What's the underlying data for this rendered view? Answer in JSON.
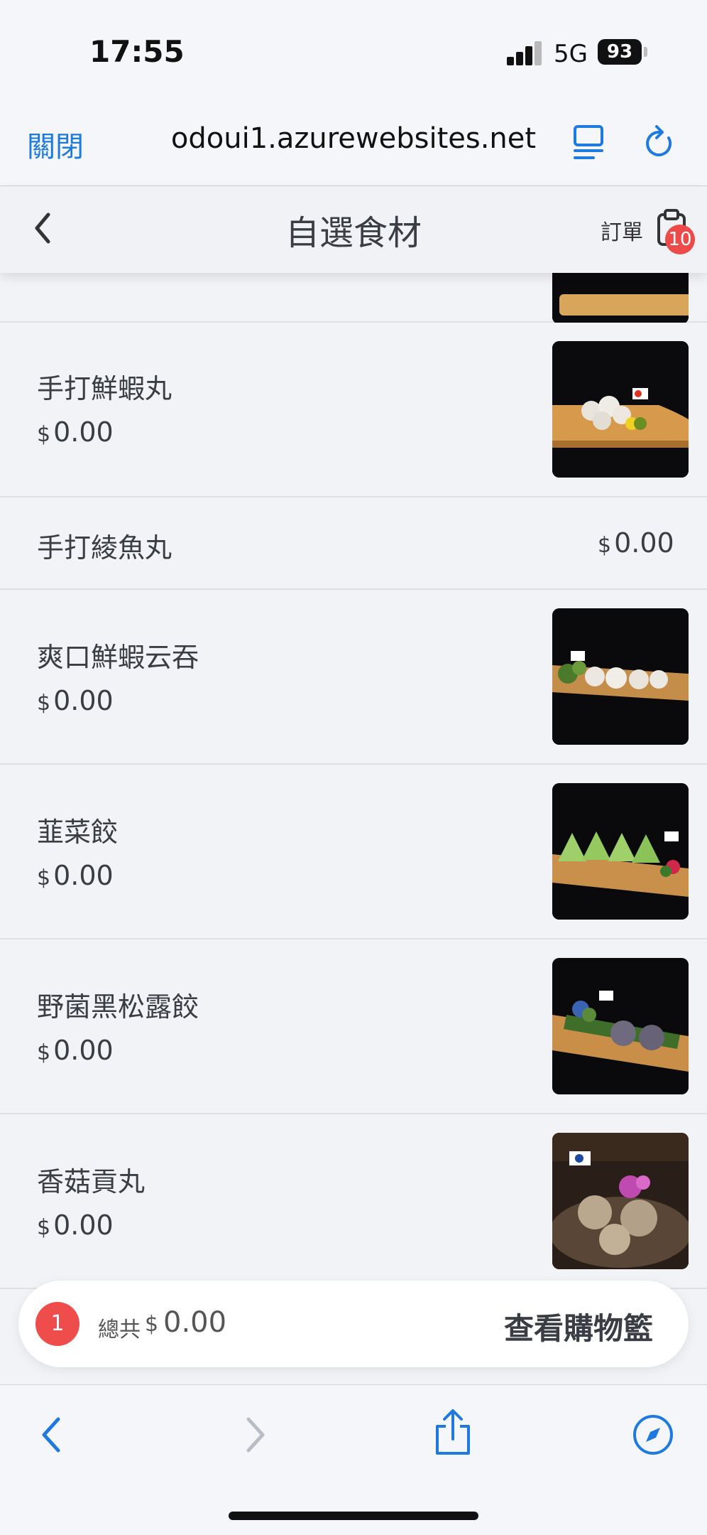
{
  "status_bar": {
    "time": "17:55",
    "network": "5G",
    "battery": "93"
  },
  "browser": {
    "close_label": "關閉",
    "url": "odoui1.azurewebsites.net"
  },
  "header": {
    "title": "自選食材",
    "order_label": "訂單",
    "order_badge": "10"
  },
  "items": [
    {
      "name": "手打鮮蝦丸",
      "currency": "$",
      "price": "0.00"
    },
    {
      "name": "手打綾魚丸",
      "currency": "$",
      "price": "0.00"
    },
    {
      "name": "爽口鮮蝦云吞",
      "currency": "$",
      "price": "0.00"
    },
    {
      "name": "韮菜餃",
      "currency": "$",
      "price": "0.00"
    },
    {
      "name": "野菌黑松露餃",
      "currency": "$",
      "price": "0.00"
    },
    {
      "name": "香菇貢丸",
      "currency": "$",
      "price": "0.00"
    }
  ],
  "cart": {
    "count": "1",
    "total_label": "總共",
    "currency": "$",
    "total": "0.00",
    "view_cart_label": "查看購物籃"
  },
  "colors": {
    "accent_blue": "#1f7ae0",
    "badge_red": "#ee4a4a"
  },
  "icons": [
    "back-chevron-icon",
    "clipboard-icon",
    "reader-icon",
    "reload-icon",
    "share-icon",
    "compass-icon",
    "forward-chevron-icon"
  ]
}
